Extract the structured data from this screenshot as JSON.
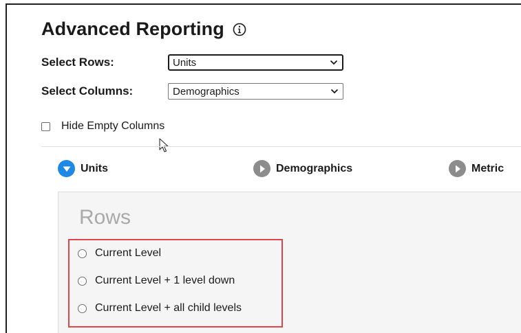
{
  "header": {
    "title": "Advanced Reporting",
    "info_icon": "info-circle-icon"
  },
  "selects": {
    "rows": {
      "label": "Select Rows:",
      "value": "Units"
    },
    "columns": {
      "label": "Select Columns:",
      "value": "Demographics"
    }
  },
  "options": {
    "hide_empty_columns": {
      "label": "Hide Empty Columns",
      "checked": false
    }
  },
  "steps": [
    {
      "label": "Units",
      "state": "expanded",
      "icon": "chevron-down-icon"
    },
    {
      "label": "Demographics",
      "state": "collapsed",
      "icon": "chevron-right-icon"
    },
    {
      "label": "Metric",
      "state": "collapsed",
      "icon": "chevron-right-icon"
    }
  ],
  "rows_panel": {
    "title": "Rows",
    "radio_options": [
      {
        "label": "Current Level",
        "selected": false
      },
      {
        "label": "Current Level + 1 level down",
        "selected": false
      },
      {
        "label": "Current Level + all child levels",
        "selected": false
      }
    ]
  },
  "colors": {
    "active_step": "#1e88e5",
    "inactive_step": "#8c8c8c",
    "highlight_border": "#e0454a",
    "panel_bg": "#f5f5f5"
  }
}
